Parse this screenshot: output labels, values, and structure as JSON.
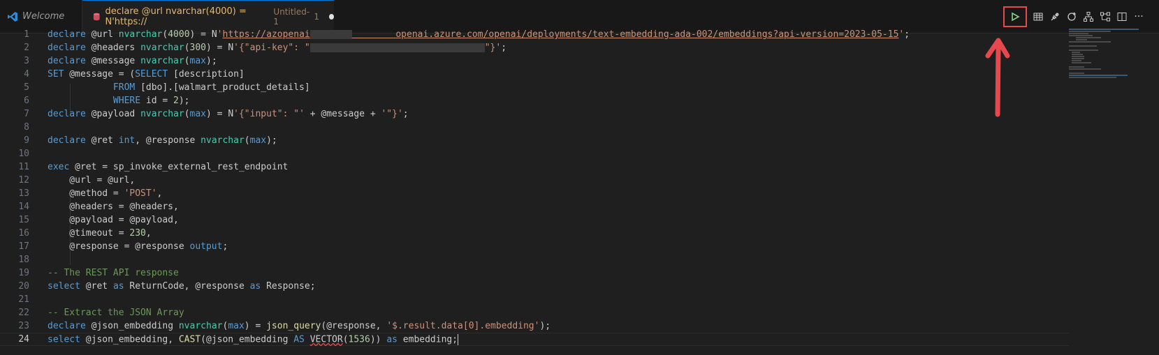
{
  "tabs": [
    {
      "label": "Welcome"
    },
    {
      "label": "declare @url nvarchar(4000) = N'https://",
      "description": "Untitled-1",
      "number": "1"
    }
  ],
  "toolbar": {
    "icons": [
      "run-icon",
      "results-grid-icon",
      "connect-icon",
      "refresh-icon",
      "explain-plan-icon",
      "split-editor-icon",
      "more-actions-icon"
    ],
    "more_label": "···"
  },
  "editor": {
    "current_line": 24,
    "lines": [
      {
        "n": "1",
        "text": "declare @url nvarchar(4000) = N'https://azopenai         openai.azure.com/openai/deployments/text-embedding-ada-002/embeddings?api-version=2023-05-15';"
      },
      {
        "n": "2",
        "text": "declare @headers nvarchar(300) = N'{\"api-key\": \"                                  \"}';"
      },
      {
        "n": "3",
        "text": "declare @message nvarchar(max);"
      },
      {
        "n": "4",
        "text": "SET @message = (SELECT [description]"
      },
      {
        "n": "5",
        "text": "            FROM [dbo].[walmart_product_details]"
      },
      {
        "n": "6",
        "text": "            WHERE id = 2);"
      },
      {
        "n": "7",
        "text": "declare @payload nvarchar(max) = N'{\"input\": \"' + @message + '\"}';"
      },
      {
        "n": "8",
        "text": ""
      },
      {
        "n": "9",
        "text": "declare @ret int, @response nvarchar(max);"
      },
      {
        "n": "10",
        "text": ""
      },
      {
        "n": "11",
        "text": "exec @ret = sp_invoke_external_rest_endpoint"
      },
      {
        "n": "12",
        "text": "    @url = @url,"
      },
      {
        "n": "13",
        "text": "    @method = 'POST',"
      },
      {
        "n": "14",
        "text": "    @headers = @headers,"
      },
      {
        "n": "15",
        "text": "    @payload = @payload,"
      },
      {
        "n": "16",
        "text": "    @timeout = 230,"
      },
      {
        "n": "17",
        "text": "    @response = @response output;"
      },
      {
        "n": "18",
        "text": ""
      },
      {
        "n": "19",
        "text": "-- The REST API response"
      },
      {
        "n": "20",
        "text": "select @ret as ReturnCode, @response as Response;"
      },
      {
        "n": "21",
        "text": ""
      },
      {
        "n": "22",
        "text": "-- Extract the JSON Array"
      },
      {
        "n": "23",
        "text": "declare @json_embedding nvarchar(max) = json_query(@response, '$.result.data[0].embedding');"
      },
      {
        "n": "24",
        "text": "select @json_embedding, CAST(@json_embedding AS VECTOR(1536)) as embedding;"
      }
    ]
  },
  "colors": {
    "annotation": "#e5484d",
    "keyword": "#569cd6",
    "string": "#ce9178",
    "comment": "#6a9955"
  }
}
